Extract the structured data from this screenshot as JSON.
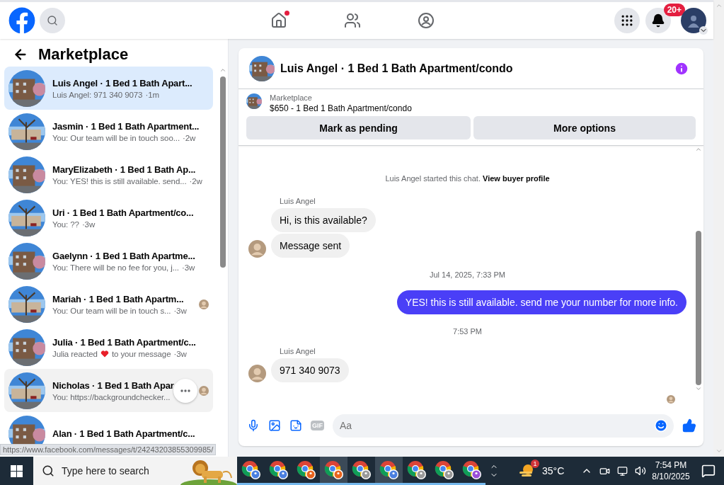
{
  "topbar": {
    "home_notification": true,
    "notifications_badge": "20+"
  },
  "sidebar": {
    "title": "Marketplace"
  },
  "conversations": [
    {
      "title": "Luis Angel · 1 Bed 1 Bath Apart...",
      "preview": "Luis Angel: 971 340 9073",
      "time": "·1m",
      "selected": true,
      "hovered": false,
      "seen": false
    },
    {
      "title": "Jasmin · 1 Bed 1 Bath Apartment...",
      "preview": "You: Our team will be in touch soo...",
      "time": "·2w",
      "selected": false,
      "hovered": false,
      "seen": false
    },
    {
      "title": "MaryElizabeth · 1 Bed 1 Bath Ap...",
      "preview": "You: YES! this is still available. send...",
      "time": "·2w",
      "selected": false,
      "hovered": false,
      "seen": false
    },
    {
      "title": "Uri · 1 Bed 1 Bath Apartment/co...",
      "preview": "You: ??",
      "time": "·3w",
      "selected": false,
      "hovered": false,
      "seen": false
    },
    {
      "title": "Gaelynn · 1 Bed 1 Bath Apartme...",
      "preview": "You: There will be no fee for you, j...",
      "time": "·3w",
      "selected": false,
      "hovered": false,
      "seen": false
    },
    {
      "title": "Mariah · 1 Bed 1 Bath Apartm...",
      "preview": "You: Our team will be in touch s...",
      "time": "·3w",
      "selected": false,
      "hovered": false,
      "seen": true
    },
    {
      "title": "Julia · 1 Bed 1 Bath Apartment/c...",
      "preview": "Julia reacted",
      "reaction_after": "to your message",
      "time": "·3w",
      "selected": false,
      "hovered": false,
      "seen": false
    },
    {
      "title": "Nicholas · 1 Bed 1 Bath Apar",
      "preview": "You: https://backgroundchecker...",
      "selected": false,
      "hovered": true,
      "seen": true
    },
    {
      "title": "Alan · 1 Bed 1 Bath Apartment/c...",
      "selected": false,
      "hovered": false,
      "seen": false
    }
  ],
  "status_url": "https://www.facebook.com/messages/t/24243203855309985/",
  "chat": {
    "title": "Luis Angel · 1 Bed 1 Bath Apartment/condo",
    "listing": {
      "label": "Marketplace",
      "name": "$650 - 1 Bed 1 Bath Apartment/condo"
    },
    "actions": [
      "Mark as pending",
      "More options"
    ],
    "items": [
      {
        "kind": "system",
        "text": "Luis Angel started this chat.",
        "link": "View buyer profile"
      },
      {
        "kind": "incoming",
        "sender": "Luis Angel",
        "bubbles": [
          "Hi, is this available?",
          "Message sent"
        ]
      },
      {
        "kind": "timestamp",
        "text": "Jul 14, 2025, 7:33 PM"
      },
      {
        "kind": "outgoing",
        "bubbles": [
          "YES! this is still available. send me your number for more info."
        ]
      },
      {
        "kind": "timestamp",
        "text": "7:53 PM"
      },
      {
        "kind": "incoming",
        "sender": "Luis Angel",
        "bubbles": [
          "971 340 9073"
        ]
      }
    ],
    "seen": true,
    "composer": {
      "placeholder": "Aa",
      "gif_label": "GIF"
    }
  },
  "taskbar": {
    "search_placeholder": "Type here to search",
    "apps": [
      {
        "color": "#4a7fe0",
        "selected": false
      },
      {
        "color": "#4a7fe0",
        "selected": false
      },
      {
        "color": "#e8641e",
        "selected": false
      },
      {
        "color": "#e8641e",
        "selected": true
      },
      {
        "color": "#9a9a9a",
        "selected": false
      },
      {
        "color": "#4a7fe0",
        "selected": true
      },
      {
        "color": "#9a9a9a",
        "selected": false
      },
      {
        "color": "#9a9a9a",
        "selected": false
      },
      {
        "color": "#9a4fd8",
        "selected": false
      }
    ],
    "weather_badge": "1",
    "temperature": "35°C",
    "time": "7:54 PM",
    "date": "8/10/2025"
  }
}
